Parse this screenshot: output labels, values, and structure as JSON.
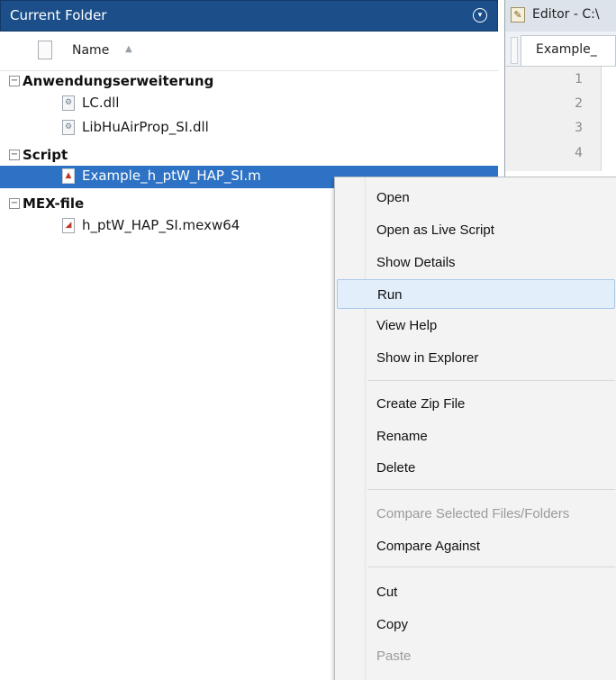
{
  "folder_panel": {
    "title": "Current Folder",
    "menu_icon": "circle-chevron-down-icon",
    "column_name": "Name",
    "groups": [
      {
        "label": "Anwendungserweiterung",
        "toggle": "⊟",
        "files": [
          {
            "name": "LC.dll",
            "icon": "dll-file-icon"
          },
          {
            "name": "LibHuAirProp_SI.dll",
            "icon": "dll-file-icon"
          }
        ]
      },
      {
        "label": "Script",
        "toggle": "⊟",
        "files": [
          {
            "name": "Example_h_ptW_HAP_SI.m",
            "icon": "matlab-script-icon",
            "selected": true
          }
        ]
      },
      {
        "label": "MEX-file",
        "toggle": "⊟",
        "files": [
          {
            "name": "h_ptW_HAP_SI.mexw64",
            "icon": "mex-file-icon"
          }
        ]
      }
    ]
  },
  "editor_panel": {
    "title": "Editor - C:\\",
    "tab_label": "Example_",
    "line_numbers": [
      "1",
      "2",
      "3",
      "4"
    ]
  },
  "context_menu": {
    "items": [
      {
        "label": "Open"
      },
      {
        "label": "Open as Live Script"
      },
      {
        "label": "Show Details"
      },
      {
        "label": "Run",
        "highlighted": true
      },
      {
        "label": "View Help"
      },
      {
        "label": "Show in Explorer"
      },
      {
        "label": "Create Zip File"
      },
      {
        "label": "Rename"
      },
      {
        "label": "Delete"
      },
      {
        "label": "Compare Selected Files/Folders",
        "disabled": true
      },
      {
        "label": "Compare Against"
      },
      {
        "label": "Cut"
      },
      {
        "label": "Copy"
      },
      {
        "label": "Paste",
        "disabled": true
      }
    ]
  },
  "colors": {
    "title_bar": "#1c4f8a",
    "selection": "#2d72c4",
    "menu_highlight": "#e3eefb"
  }
}
